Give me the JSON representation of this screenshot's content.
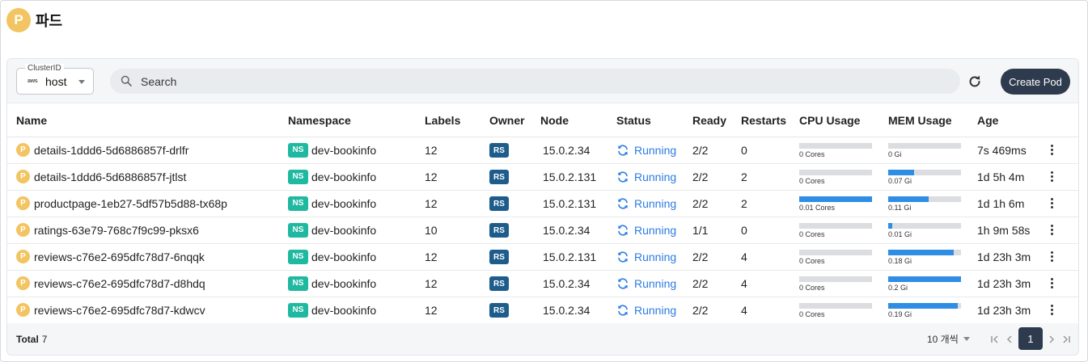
{
  "header": {
    "badge": "P",
    "title": "파드"
  },
  "toolbar": {
    "cluster_label": "ClusterID",
    "cluster_provider": "aws",
    "cluster_value": "host",
    "search_placeholder": "Search",
    "create_label": "Create Pod"
  },
  "colors": {
    "accent_dark": "#2e3a4e",
    "pod_badge": "#f2c462",
    "ns_badge": "#1fb8a0",
    "rs_badge": "#1e5c8c",
    "running": "#2c7be5",
    "bar_fill": "#2f8de4"
  },
  "table": {
    "columns": [
      "Name",
      "Namespace",
      "Labels",
      "Owner",
      "Node",
      "Status",
      "Ready",
      "Restarts",
      "CPU Usage",
      "MEM Usage",
      "Age"
    ],
    "rows": [
      {
        "badge": "P",
        "name": "details-1ddd6-5d6886857f-drlfr",
        "ns_badge": "NS",
        "namespace": "dev-bookinfo",
        "labels": "12",
        "owner": "RS",
        "node": "15.0.2.34",
        "status": "Running",
        "ready": "2/2",
        "restarts": "0",
        "cpu_label": "0 Cores",
        "cpu_pct": 0,
        "mem_label": "0 Gi",
        "mem_pct": 0,
        "age": "7s 469ms"
      },
      {
        "badge": "P",
        "name": "details-1ddd6-5d6886857f-jtlst",
        "ns_badge": "NS",
        "namespace": "dev-bookinfo",
        "labels": "12",
        "owner": "RS",
        "node": "15.0.2.131",
        "status": "Running",
        "ready": "2/2",
        "restarts": "2",
        "cpu_label": "0 Cores",
        "cpu_pct": 0,
        "mem_label": "0.07 Gi",
        "mem_pct": 35,
        "age": "1d 5h 4m"
      },
      {
        "badge": "P",
        "name": "productpage-1eb27-5df57b5d88-tx68p",
        "ns_badge": "NS",
        "namespace": "dev-bookinfo",
        "labels": "12",
        "owner": "RS",
        "node": "15.0.2.131",
        "status": "Running",
        "ready": "2/2",
        "restarts": "2",
        "cpu_label": "0.01 Cores",
        "cpu_pct": 100,
        "mem_label": "0.11 Gi",
        "mem_pct": 55,
        "age": "1d 1h 6m"
      },
      {
        "badge": "P",
        "name": "ratings-63e79-768c7f9c99-pksx6",
        "ns_badge": "NS",
        "namespace": "dev-bookinfo",
        "labels": "10",
        "owner": "RS",
        "node": "15.0.2.34",
        "status": "Running",
        "ready": "1/1",
        "restarts": "0",
        "cpu_label": "0 Cores",
        "cpu_pct": 0,
        "mem_label": "0.01 Gi",
        "mem_pct": 5,
        "age": "1h 9m 58s"
      },
      {
        "badge": "P",
        "name": "reviews-c76e2-695dfc78d7-6nqqk",
        "ns_badge": "NS",
        "namespace": "dev-bookinfo",
        "labels": "12",
        "owner": "RS",
        "node": "15.0.2.131",
        "status": "Running",
        "ready": "2/2",
        "restarts": "4",
        "cpu_label": "0 Cores",
        "cpu_pct": 0,
        "mem_label": "0.18 Gi",
        "mem_pct": 90,
        "age": "1d 23h 3m"
      },
      {
        "badge": "P",
        "name": "reviews-c76e2-695dfc78d7-d8hdq",
        "ns_badge": "NS",
        "namespace": "dev-bookinfo",
        "labels": "12",
        "owner": "RS",
        "node": "15.0.2.34",
        "status": "Running",
        "ready": "2/2",
        "restarts": "4",
        "cpu_label": "0 Cores",
        "cpu_pct": 0,
        "mem_label": "0.2 Gi",
        "mem_pct": 100,
        "age": "1d 23h 3m"
      },
      {
        "badge": "P",
        "name": "reviews-c76e2-695dfc78d7-kdwcv",
        "ns_badge": "NS",
        "namespace": "dev-bookinfo",
        "labels": "12",
        "owner": "RS",
        "node": "15.0.2.34",
        "status": "Running",
        "ready": "2/2",
        "restarts": "4",
        "cpu_label": "0 Cores",
        "cpu_pct": 0,
        "mem_label": "0.19 Gi",
        "mem_pct": 95,
        "age": "1d 23h 3m"
      }
    ]
  },
  "footer": {
    "total_label": "Total",
    "total_count": "7",
    "per_page": "10 개씩",
    "current_page": "1"
  }
}
